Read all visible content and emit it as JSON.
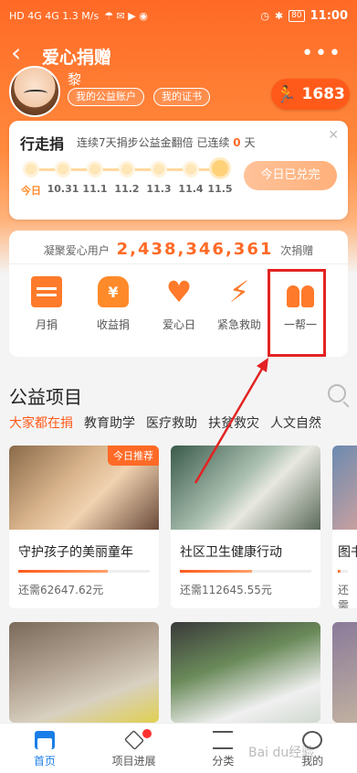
{
  "status": {
    "left_text": "HD 4G 4G 1.3 M/s",
    "battery": "80",
    "time": "11:00"
  },
  "header": {
    "title": "爱心捐赠",
    "back_icon": "chevron-left-icon",
    "more_icon": "more-icon"
  },
  "profile": {
    "username": "黎",
    "account_btn": "我的公益账户",
    "cert_btn": "我的证书",
    "steps": "1683",
    "steps_icon": "runner-icon"
  },
  "walk": {
    "title": "行走捐",
    "subtitle_pre": "连续7天捐步公益金翻倍 已连续",
    "streak": "0",
    "subtitle_post": "天",
    "days": [
      "今日",
      "10.31",
      "11.1",
      "11.2",
      "11.3",
      "11.4",
      "11.5"
    ],
    "done_label": "今日已兑完"
  },
  "donate": {
    "pre": "凝聚爱心用户",
    "count": "2,438,346,361",
    "post": "次捐赠",
    "categories": [
      {
        "label": "月捐",
        "icon": "calendar-icon"
      },
      {
        "label": "收益捐",
        "icon": "money-bag-icon"
      },
      {
        "label": "爱心日",
        "icon": "heart-hand-icon"
      },
      {
        "label": "紧急救助",
        "icon": "lightning-icon"
      },
      {
        "label": "一帮一",
        "icon": "pair-icon"
      }
    ]
  },
  "section": {
    "title": "公益项目",
    "filters": [
      "大家都在捐",
      "教育助学",
      "医疗救助",
      "扶贫救灾",
      "人文自然"
    ]
  },
  "projects": [
    {
      "name": "守护孩子的美丽童年",
      "need": "还需62647.62元",
      "tag": "今日推荐",
      "progress": 0.68
    },
    {
      "name": "社区卫生健康行动",
      "need": "还需112645.55元",
      "tag": "",
      "progress": 0.55
    },
    {
      "name": "图书",
      "need": "还需",
      "tag": "",
      "progress": 0.3
    },
    {
      "name": "",
      "need": "",
      "tag": "",
      "progress": 0
    },
    {
      "name": "",
      "need": "",
      "tag": "",
      "progress": 0
    }
  ],
  "nav": [
    {
      "label": "首页",
      "icon": "home-icon"
    },
    {
      "label": "项目进展",
      "icon": "layers-icon"
    },
    {
      "label": "分类",
      "icon": "list-icon"
    },
    {
      "label": "我的",
      "icon": "user-icon"
    }
  ],
  "watermark": "Bai du经验",
  "colors": {
    "accent": "#ff6a26",
    "nav_active": "#1a7ee8",
    "annotation": "#e32222"
  }
}
